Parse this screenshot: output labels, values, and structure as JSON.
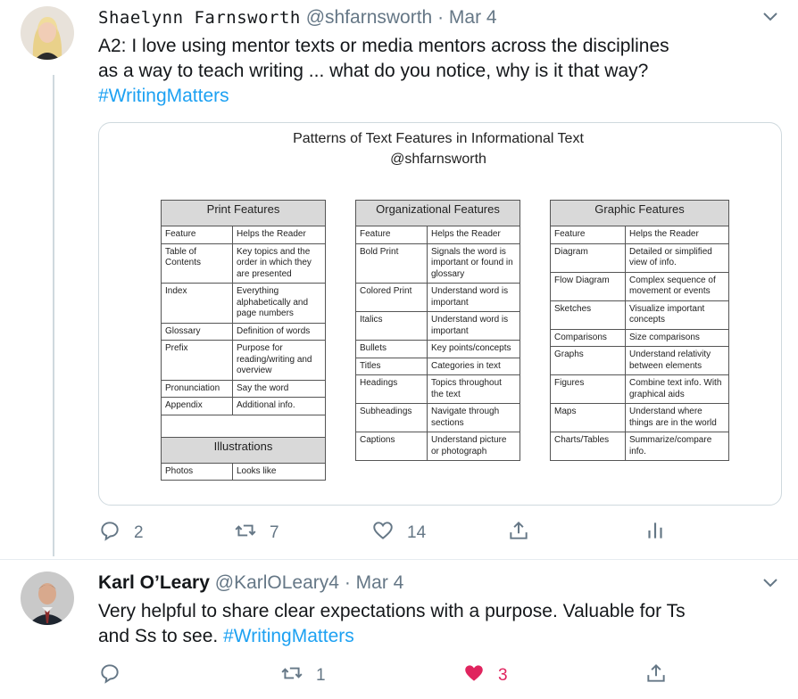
{
  "tweets": [
    {
      "name": "Shaelynn Farnsworth",
      "handle": "@shfarnsworth",
      "separator": "·",
      "date": "Mar 4",
      "text_lines": [
        "A2: I love using mentor texts or media mentors across the disciplines",
        "as a way to teach writing ... what do you notice, why is it that way?"
      ],
      "hashtag": "#WritingMatters",
      "actions": {
        "reply": "2",
        "retweet": "7",
        "like": "14"
      }
    },
    {
      "name": "Karl O’Leary",
      "handle": "@KarlOLeary4",
      "separator": "·",
      "date": "Mar 4",
      "text_line1": "Very helpful to share clear expectations with a purpose. Valuable for Ts",
      "text_line2_prefix": "and Ss to see. ",
      "hashtag": "#WritingMatters",
      "actions": {
        "reply": "",
        "retweet": "1",
        "like": "3"
      }
    }
  ],
  "media": {
    "title": "Patterns of Text Features in Informational Text",
    "subtitle": "@shfarnsworth",
    "tables": [
      {
        "heading": "Print Features",
        "col1": "Feature",
        "col2": "Helps the Reader",
        "rows": [
          [
            "Table of Contents",
            "Key topics and the order in which they are presented"
          ],
          [
            "Index",
            "Everything alphabetically and page numbers"
          ],
          [
            "Glossary",
            "Definition of words"
          ],
          [
            "Prefix",
            "Purpose for reading/writing and overview"
          ],
          [
            "Pronunciation",
            "Say the word"
          ],
          [
            "Appendix",
            "Additional info."
          ]
        ],
        "subheading": "Illustrations",
        "subrows": [
          [
            "Photos",
            "Looks like"
          ]
        ]
      },
      {
        "heading": "Organizational Features",
        "col1": "Feature",
        "col2": "Helps the Reader",
        "rows": [
          [
            "Bold Print",
            "Signals the word is important or found in glossary"
          ],
          [
            "Colored Print",
            "Understand word is important"
          ],
          [
            "Italics",
            "Understand word is important"
          ],
          [
            "Bullets",
            "Key points/concepts"
          ],
          [
            "Titles",
            "Categories in text"
          ],
          [
            "Headings",
            "Topics throughout the text"
          ],
          [
            "Subheadings",
            "Navigate through sections"
          ],
          [
            "Captions",
            "Understand picture or photograph"
          ]
        ]
      },
      {
        "heading": "Graphic Features",
        "col1": "Feature",
        "col2": "Helps the Reader",
        "rows": [
          [
            "Diagram",
            "Detailed or simplified view of info."
          ],
          [
            "Flow Diagram",
            "Complex sequence of movement or events"
          ],
          [
            "Sketches",
            "Visualize important concepts"
          ],
          [
            "Comparisons",
            "Size comparisons"
          ],
          [
            "Graphs",
            "Understand relativity between elements"
          ],
          [
            "Figures",
            "Combine text info. With graphical aids"
          ],
          [
            "Maps",
            "Understand where things are in the world"
          ],
          [
            "Charts/Tables",
            "Summarize/compare info."
          ]
        ]
      }
    ]
  },
  "colors": {
    "accent": "#1da1f2",
    "muted": "#657786",
    "like": "#e0245e",
    "text": "#14171a"
  },
  "icons": [
    "reply-icon",
    "retweet-icon",
    "like-icon",
    "share-icon",
    "analytics-icon",
    "chevron-down-icon"
  ]
}
